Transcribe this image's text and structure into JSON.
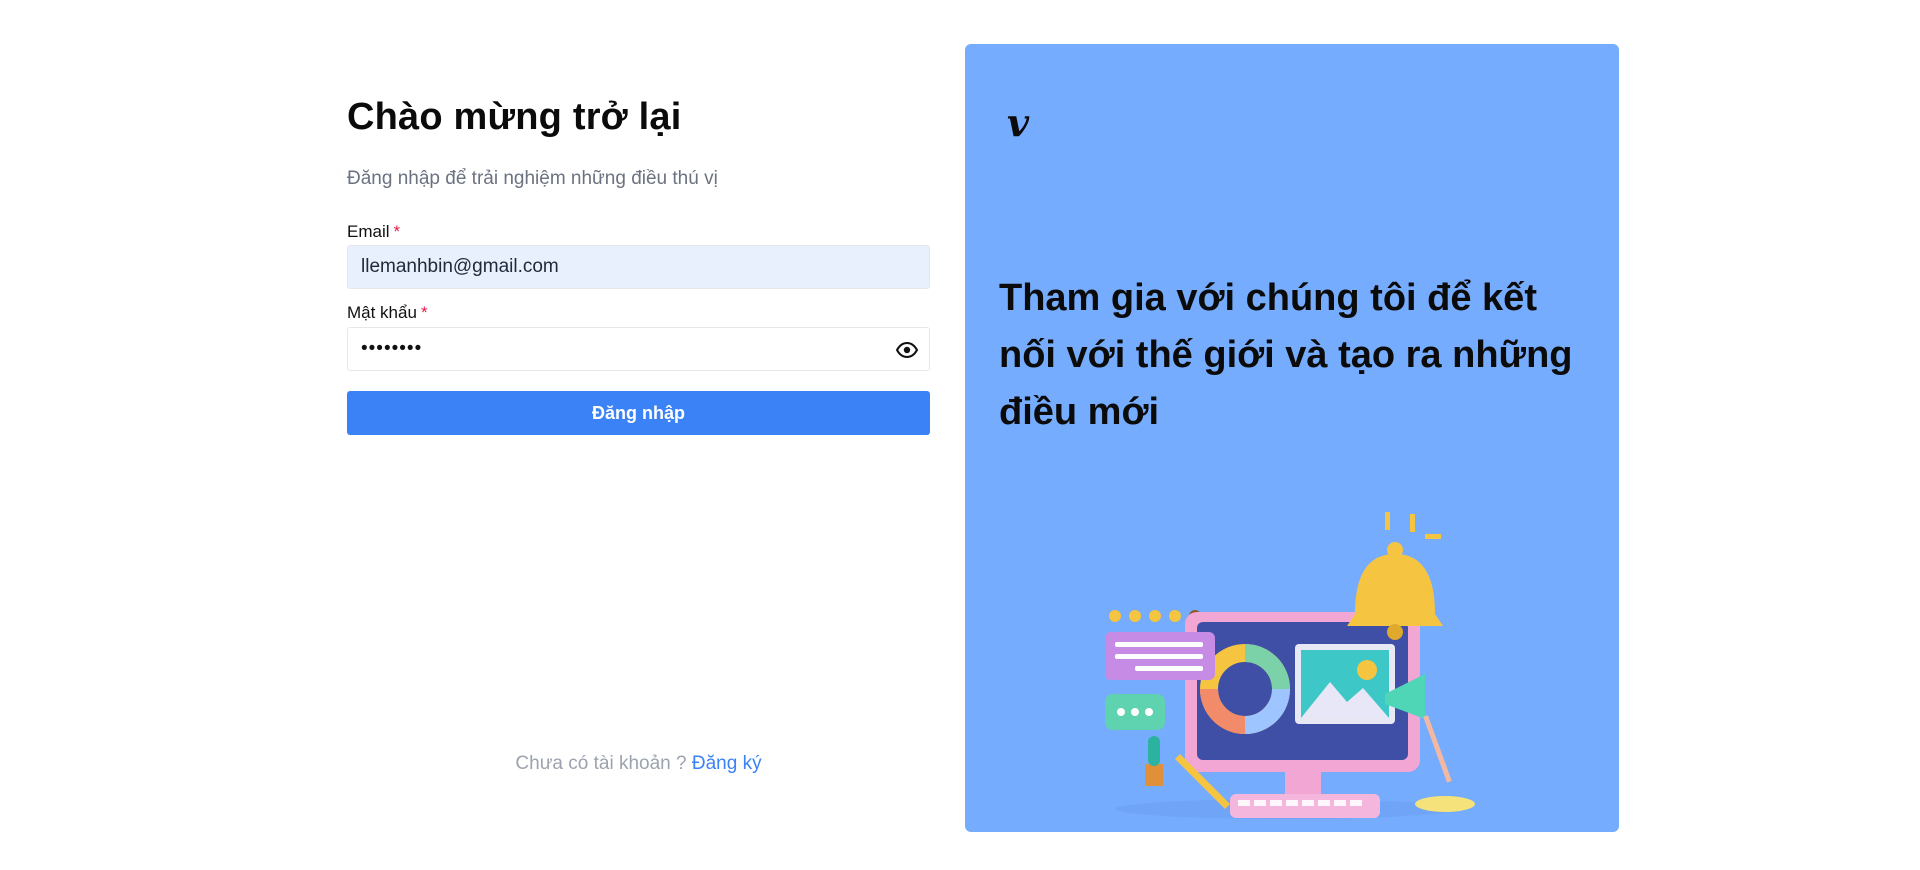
{
  "login": {
    "title": "Chào mừng trở lại",
    "subtitle": "Đăng nhập để trải nghiệm những điều thú vị",
    "email_label": "Email",
    "email_value": "llemanhbin@gmail.com",
    "password_label": "Mật khẩu",
    "password_value": "••••••••",
    "required_mark": "*",
    "submit_label": "Đăng nhập",
    "no_account_text": "Chưa có tài khoản ?",
    "signup_link": "Đăng ký"
  },
  "panel": {
    "logo": "v",
    "headline": "Tham gia với chúng tôi để kết nối với thế giới và tạo ra những điều mới",
    "illustration": "computer-design-illustration"
  },
  "colors": {
    "primary": "#3b82f6",
    "panel_bg": "#76acfd",
    "email_bg": "#e8f0fe",
    "required": "#e11d48"
  },
  "icons": {
    "password_toggle": "eye-icon"
  }
}
